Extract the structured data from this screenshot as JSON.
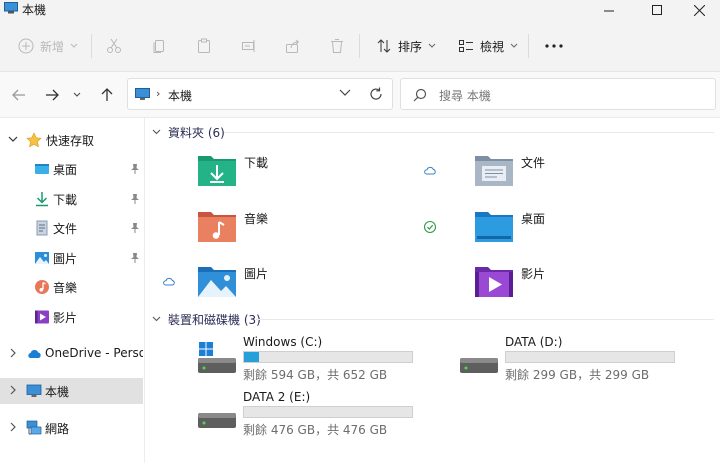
{
  "window": {
    "title": "本機"
  },
  "toolbar": {
    "new_label": "新增",
    "sort_label": "排序",
    "view_label": "檢視"
  },
  "address": {
    "crumb": "本機"
  },
  "search": {
    "placeholder": "搜尋 本機"
  },
  "sidebar": {
    "quick_access": "快速存取",
    "quick_items": [
      "桌面",
      "下載",
      "文件",
      "圖片",
      "音樂",
      "影片"
    ],
    "onedrive": "OneDrive - Persona",
    "this_pc": "本機",
    "network": "網路"
  },
  "folders_group": {
    "label": "資料夾 (6)"
  },
  "folders": [
    {
      "name": "下載",
      "icon": "download-folder-icon",
      "status": ""
    },
    {
      "name": "文件",
      "icon": "documents-folder-icon",
      "status": "cloud-icon"
    },
    {
      "name": "音樂",
      "icon": "music-folder-icon",
      "status": ""
    },
    {
      "name": "桌面",
      "icon": "desktop-folder-icon",
      "status": "synced-check-icon"
    },
    {
      "name": "圖片",
      "icon": "pictures-folder-icon",
      "status": "cloud-icon"
    },
    {
      "name": "影片",
      "icon": "videos-folder-icon",
      "status": ""
    }
  ],
  "drives_group": {
    "label": "裝置和磁碟機 (3)"
  },
  "drives": [
    {
      "name": "Windows  (C:)",
      "free": "剩餘 594 GB，共 652 GB",
      "used_percent": 9
    },
    {
      "name": "DATA (D:)",
      "free": "剩餘 299 GB，共 299 GB",
      "used_percent": 0
    },
    {
      "name": "DATA 2 (E:)",
      "free": "剩餘 476 GB，共 476 GB",
      "used_percent": 0
    }
  ],
  "colors": {
    "accent": "#26a0da",
    "selected": "#e1e1e1",
    "chrome": "#f3f3f3"
  }
}
